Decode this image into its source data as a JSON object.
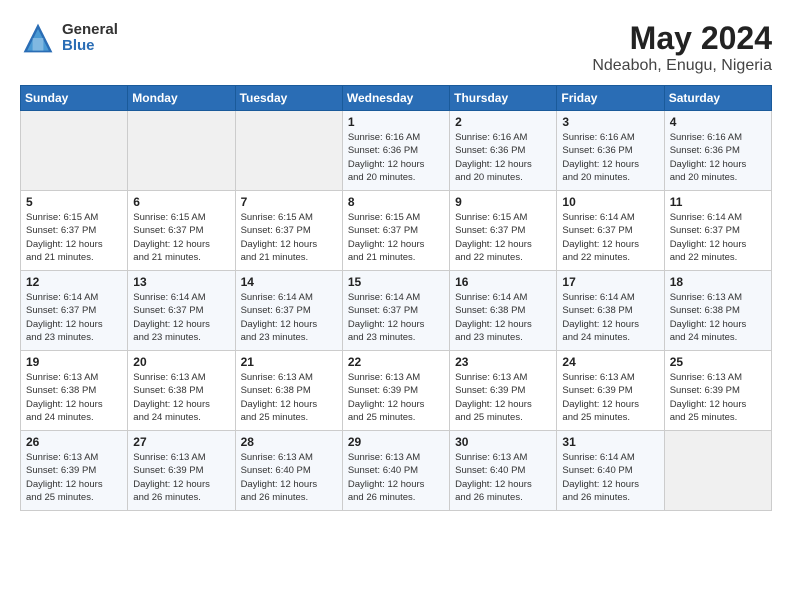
{
  "header": {
    "logo_general": "General",
    "logo_blue": "Blue",
    "title": "May 2024",
    "subtitle": "Ndeaboh, Enugu, Nigeria"
  },
  "days_of_week": [
    "Sunday",
    "Monday",
    "Tuesday",
    "Wednesday",
    "Thursday",
    "Friday",
    "Saturday"
  ],
  "weeks": [
    [
      {
        "day": "",
        "info": ""
      },
      {
        "day": "",
        "info": ""
      },
      {
        "day": "",
        "info": ""
      },
      {
        "day": "1",
        "info": "Sunrise: 6:16 AM\nSunset: 6:36 PM\nDaylight: 12 hours\nand 20 minutes."
      },
      {
        "day": "2",
        "info": "Sunrise: 6:16 AM\nSunset: 6:36 PM\nDaylight: 12 hours\nand 20 minutes."
      },
      {
        "day": "3",
        "info": "Sunrise: 6:16 AM\nSunset: 6:36 PM\nDaylight: 12 hours\nand 20 minutes."
      },
      {
        "day": "4",
        "info": "Sunrise: 6:16 AM\nSunset: 6:36 PM\nDaylight: 12 hours\nand 20 minutes."
      }
    ],
    [
      {
        "day": "5",
        "info": "Sunrise: 6:15 AM\nSunset: 6:37 PM\nDaylight: 12 hours\nand 21 minutes."
      },
      {
        "day": "6",
        "info": "Sunrise: 6:15 AM\nSunset: 6:37 PM\nDaylight: 12 hours\nand 21 minutes."
      },
      {
        "day": "7",
        "info": "Sunrise: 6:15 AM\nSunset: 6:37 PM\nDaylight: 12 hours\nand 21 minutes."
      },
      {
        "day": "8",
        "info": "Sunrise: 6:15 AM\nSunset: 6:37 PM\nDaylight: 12 hours\nand 21 minutes."
      },
      {
        "day": "9",
        "info": "Sunrise: 6:15 AM\nSunset: 6:37 PM\nDaylight: 12 hours\nand 22 minutes."
      },
      {
        "day": "10",
        "info": "Sunrise: 6:14 AM\nSunset: 6:37 PM\nDaylight: 12 hours\nand 22 minutes."
      },
      {
        "day": "11",
        "info": "Sunrise: 6:14 AM\nSunset: 6:37 PM\nDaylight: 12 hours\nand 22 minutes."
      }
    ],
    [
      {
        "day": "12",
        "info": "Sunrise: 6:14 AM\nSunset: 6:37 PM\nDaylight: 12 hours\nand 23 minutes."
      },
      {
        "day": "13",
        "info": "Sunrise: 6:14 AM\nSunset: 6:37 PM\nDaylight: 12 hours\nand 23 minutes."
      },
      {
        "day": "14",
        "info": "Sunrise: 6:14 AM\nSunset: 6:37 PM\nDaylight: 12 hours\nand 23 minutes."
      },
      {
        "day": "15",
        "info": "Sunrise: 6:14 AM\nSunset: 6:37 PM\nDaylight: 12 hours\nand 23 minutes."
      },
      {
        "day": "16",
        "info": "Sunrise: 6:14 AM\nSunset: 6:38 PM\nDaylight: 12 hours\nand 23 minutes."
      },
      {
        "day": "17",
        "info": "Sunrise: 6:14 AM\nSunset: 6:38 PM\nDaylight: 12 hours\nand 24 minutes."
      },
      {
        "day": "18",
        "info": "Sunrise: 6:13 AM\nSunset: 6:38 PM\nDaylight: 12 hours\nand 24 minutes."
      }
    ],
    [
      {
        "day": "19",
        "info": "Sunrise: 6:13 AM\nSunset: 6:38 PM\nDaylight: 12 hours\nand 24 minutes."
      },
      {
        "day": "20",
        "info": "Sunrise: 6:13 AM\nSunset: 6:38 PM\nDaylight: 12 hours\nand 24 minutes."
      },
      {
        "day": "21",
        "info": "Sunrise: 6:13 AM\nSunset: 6:38 PM\nDaylight: 12 hours\nand 25 minutes."
      },
      {
        "day": "22",
        "info": "Sunrise: 6:13 AM\nSunset: 6:39 PM\nDaylight: 12 hours\nand 25 minutes."
      },
      {
        "day": "23",
        "info": "Sunrise: 6:13 AM\nSunset: 6:39 PM\nDaylight: 12 hours\nand 25 minutes."
      },
      {
        "day": "24",
        "info": "Sunrise: 6:13 AM\nSunset: 6:39 PM\nDaylight: 12 hours\nand 25 minutes."
      },
      {
        "day": "25",
        "info": "Sunrise: 6:13 AM\nSunset: 6:39 PM\nDaylight: 12 hours\nand 25 minutes."
      }
    ],
    [
      {
        "day": "26",
        "info": "Sunrise: 6:13 AM\nSunset: 6:39 PM\nDaylight: 12 hours\nand 25 minutes."
      },
      {
        "day": "27",
        "info": "Sunrise: 6:13 AM\nSunset: 6:39 PM\nDaylight: 12 hours\nand 26 minutes."
      },
      {
        "day": "28",
        "info": "Sunrise: 6:13 AM\nSunset: 6:40 PM\nDaylight: 12 hours\nand 26 minutes."
      },
      {
        "day": "29",
        "info": "Sunrise: 6:13 AM\nSunset: 6:40 PM\nDaylight: 12 hours\nand 26 minutes."
      },
      {
        "day": "30",
        "info": "Sunrise: 6:13 AM\nSunset: 6:40 PM\nDaylight: 12 hours\nand 26 minutes."
      },
      {
        "day": "31",
        "info": "Sunrise: 6:14 AM\nSunset: 6:40 PM\nDaylight: 12 hours\nand 26 minutes."
      },
      {
        "day": "",
        "info": ""
      }
    ]
  ]
}
